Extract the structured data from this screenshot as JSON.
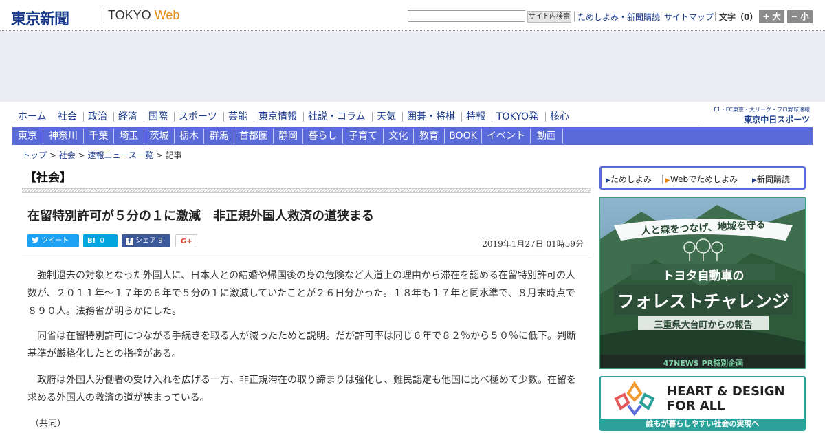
{
  "header": {
    "logo": "東京新聞",
    "logo_sub": "TOKYO",
    "logo_web": "Web",
    "search_button": "サイト内検索",
    "links": [
      "ためしよみ・新聞購読",
      "サイトマップ"
    ],
    "font_size_label": "文字（0）",
    "font_plus": "+ 大",
    "font_minus": "− 小"
  },
  "nav_primary": [
    "ホーム",
    "社会",
    "政治",
    "経済",
    "国際",
    "スポーツ",
    "芸能",
    "東京情報",
    "社説・コラム",
    "天気",
    "囲碁・将棋",
    "特報",
    "TOKYO発",
    "核心"
  ],
  "chunichi": {
    "top": "F1・FC東京・大リーグ・プロ野球速報",
    "main": "東京中日スポーツ"
  },
  "nav_regions": [
    "東京",
    "神奈川",
    "千葉",
    "埼玉",
    "茨城",
    "栃木",
    "群馬",
    "首都圏",
    "静岡",
    "暮らし",
    "子育て",
    "文化",
    "教育",
    "BOOK",
    "イベント",
    "動画"
  ],
  "breadcrumb": {
    "items": [
      "トップ",
      "社会",
      "速報ニュース一覧"
    ],
    "current": "記事",
    "sep": ">"
  },
  "article": {
    "section": "【社会】",
    "headline": "在留特別許可が５分の１に激減　非正規外国人救済の道狭まる",
    "share": {
      "tweet": "ツイート",
      "hatena_count": "0",
      "fb_label": "シェア",
      "fb_count": "9"
    },
    "date": "2019年1月27日 01時59分",
    "paragraphs": [
      "　強制退去の対象となった外国人に、日本人との結婚や帰国後の身の危険など人道上の理由から滞在を認める在留特別許可の人数が、２０１１年～１７年の６年で５分の１に激減していたことが２６日分かった。１８年も１７年と同水準で、８月末時点で８９０人。法務省が明らかにした。",
      "　同省は在留特別許可につながる手続きを取る人が減ったためと説明。だが許可率は同じ６年で８２％から５０％に低下。判断基準が厳格化したとの指摘がある。",
      "　政府は外国人労働者の受け入れを広げる一方、非正規滞在の取り締まりは強化し、難民認定も他国に比べ極めて少数。在留を求める外国人の救済の道が狭まっている。"
    ],
    "credit": "（共同）"
  },
  "sidebar": {
    "promo_links": [
      "ためしよみ",
      "Webでためしよみ",
      "新聞購読"
    ],
    "forest_ad": {
      "banner": "人と森をつなげ、地域を守る",
      "brand": "トヨタ自動車の",
      "title": "フォレストチャレンジ",
      "subtitle": "三重県大台町からの報告",
      "footer": "47NEWS PR特別企画"
    },
    "heart_ad": {
      "title_line1": "HEART & DESIGN",
      "title_line2": "FOR ALL",
      "bar": "誰もが暮らしやすい社会の実現へ"
    }
  },
  "colors": {
    "brand_blue": "#1a3a8c",
    "nav_blue": "#5a6bd9",
    "accent_orange": "#e8870e",
    "teal": "#2aa29a"
  }
}
